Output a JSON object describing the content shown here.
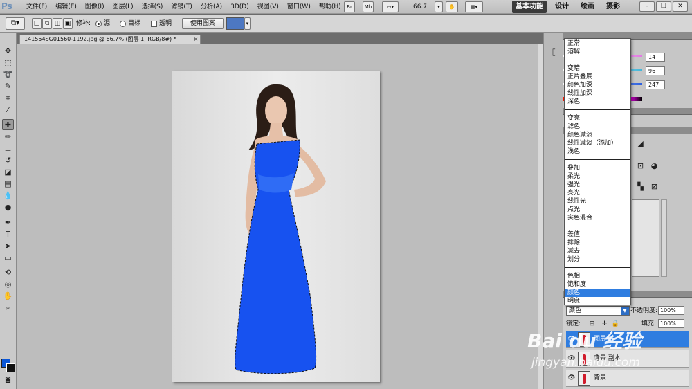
{
  "app": {
    "logo": "Ps"
  },
  "menu": {
    "items": [
      "文件(F)",
      "编辑(E)",
      "图像(I)",
      "图层(L)",
      "选择(S)",
      "滤镜(T)",
      "分析(A)",
      "3D(D)",
      "视图(V)",
      "窗口(W)",
      "帮助(H)"
    ]
  },
  "toolbar": {
    "bridge_label": "Br",
    "minibridge_label": "Mb",
    "zoom": "66.7"
  },
  "workspaces": {
    "basic": "基本功能",
    "design": "设计",
    "paint": "绘画",
    "photo": "摄影"
  },
  "options": {
    "repair_label": "修补:",
    "source_label": "源",
    "target_label": "目标",
    "transparent_label": "透明",
    "use_pattern_label": "使用图案"
  },
  "document": {
    "tab_title": "141554SG01560-1192.jpg @ 66.7% (图层 1, RGB/8#) *",
    "close_glyph": "×"
  },
  "colors": {
    "foreground": "#0a56d8",
    "background": "#111111",
    "dress": "#1752f0",
    "selection_highlight": "#2f7de0"
  },
  "color_panel": {
    "values": [
      "14",
      "96",
      "247"
    ]
  },
  "blend_modes": {
    "groups": [
      [
        "正常",
        "溶解"
      ],
      [
        "变暗",
        "正片叠底",
        "颜色加深",
        "线性加深",
        "深色"
      ],
      [
        "变亮",
        "滤色",
        "颜色减淡",
        "线性减淡（添加）",
        "浅色"
      ],
      [
        "叠加",
        "柔光",
        "强光",
        "亮光",
        "线性光",
        "点光",
        "实色混合"
      ],
      [
        "差值",
        "排除",
        "减去",
        "划分"
      ],
      [
        "色相",
        "饱和度",
        "颜色",
        "明度"
      ]
    ],
    "selected": "颜色"
  },
  "layers": {
    "blend_mode": "颜色",
    "opacity_label": "不透明度:",
    "opacity": "100%",
    "lock_label": "锁定:",
    "fill_label": "填充:",
    "fill": "100%",
    "rows": [
      {
        "name": "图层 1",
        "selected": true
      },
      {
        "name": "背景 副本",
        "selected": false
      },
      {
        "name": "背景",
        "selected": false
      }
    ]
  },
  "watermark": {
    "brand": "Bai du 经验",
    "url": "jingyan.baidu.com"
  }
}
